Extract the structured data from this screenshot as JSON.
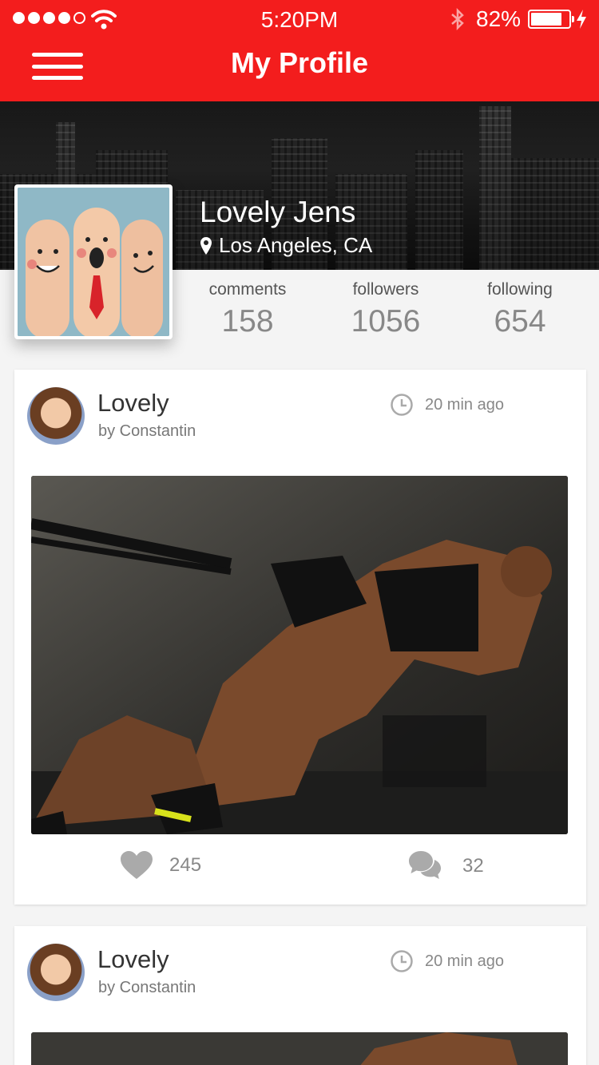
{
  "status_bar": {
    "time": "5:20PM",
    "battery": "82%",
    "battery_level": 0.82
  },
  "header": {
    "title": "My Profile"
  },
  "profile": {
    "name": "Lovely Jens",
    "location": "Los Angeles, CA"
  },
  "stats": [
    {
      "label": "comments",
      "value": "158"
    },
    {
      "label": "followers",
      "value": "1056"
    },
    {
      "label": "following",
      "value": "654"
    }
  ],
  "posts": [
    {
      "title": "Lovely",
      "author": "by Constantin",
      "time": "20 min ago",
      "likes": "245",
      "comments": "32"
    },
    {
      "title": "Lovely",
      "author": "by Constantin",
      "time": "20 min ago",
      "likes": "",
      "comments": ""
    }
  ],
  "colors": {
    "accent": "#f31d1d",
    "muted": "#888888"
  },
  "icons": {
    "menu": "hamburger-icon",
    "location": "location-pin-icon",
    "time": "clock-icon",
    "like": "heart-icon",
    "comment": "chat-bubbles-icon"
  }
}
